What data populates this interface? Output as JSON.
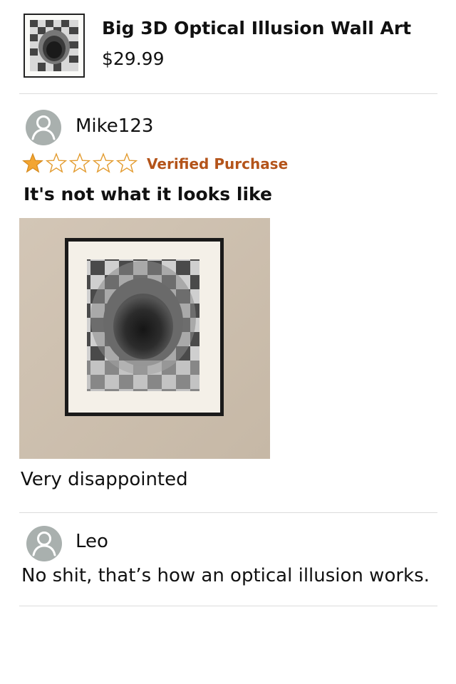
{
  "product": {
    "title": "Big 3D Optical Illusion Wall Art",
    "price": "$29.99",
    "thumbnail_icon": "optical-illusion-checker-tunnel"
  },
  "review": {
    "username": "Mike123",
    "avatar_icon": "user-silhouette",
    "rating": 1,
    "max_rating": 5,
    "verified_label": "Verified Purchase",
    "title": "It's not what it looks like",
    "photo_icon": "framed-optical-illusion-photo",
    "body": "Very disappointed"
  },
  "reply": {
    "username": "Leo",
    "avatar_icon": "user-silhouette",
    "body": "No shit, that’s how an optical illusion works."
  },
  "colors": {
    "star_filled": "#f3a531",
    "star_outline": "#e39b2e",
    "verified": "#b4541a",
    "avatar_bg": "#a9b0ae",
    "divider": "#dcdcdc",
    "wall": "#cdbfae"
  }
}
